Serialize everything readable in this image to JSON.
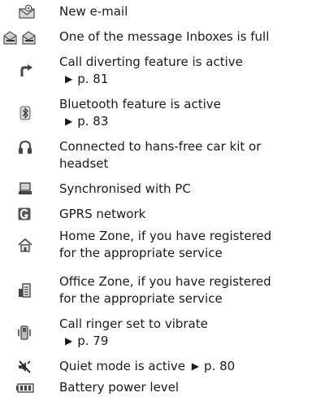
{
  "icon_list": {
    "arrow_glyph": "▶",
    "items": [
      {
        "icon": "new-email-icon",
        "lines": [
          "New e-mail"
        ],
        "ref": ""
      },
      {
        "icon": "inbox-full-icon",
        "lines": [
          "One of the message Inboxes is full"
        ],
        "ref": ""
      },
      {
        "icon": "call-divert-icon",
        "lines": [
          "Call diverting feature is active"
        ],
        "ref": "p. 81"
      },
      {
        "icon": "bluetooth-icon",
        "lines": [
          "Bluetooth feature is active"
        ],
        "ref": "p. 83"
      },
      {
        "icon": "headset-icon",
        "lines": [
          "Connected to hans-free car kit or",
          "headset"
        ],
        "ref": ""
      },
      {
        "icon": "pc-sync-icon",
        "lines": [
          "Synchronised with PC"
        ],
        "ref": ""
      },
      {
        "icon": "gprs-icon",
        "lines": [
          "GPRS network"
        ],
        "ref": ""
      },
      {
        "icon": "home-zone-icon",
        "lines": [
          "Home Zone, if you have registered",
          "for the appropriate service"
        ],
        "ref": ""
      },
      {
        "icon": "office-zone-icon",
        "lines": [
          "Office Zone, if you have registered",
          "for the appropriate service"
        ],
        "ref": ""
      },
      {
        "icon": "vibrate-icon",
        "lines": [
          "Call ringer set to vibrate"
        ],
        "ref": "p. 79"
      },
      {
        "icon": "quiet-mode-icon",
        "lines": [
          "Quiet mode is active"
        ],
        "ref": "p. 80"
      },
      {
        "icon": "battery-icon",
        "lines": [
          "Battery power level"
        ],
        "ref": ""
      }
    ]
  }
}
